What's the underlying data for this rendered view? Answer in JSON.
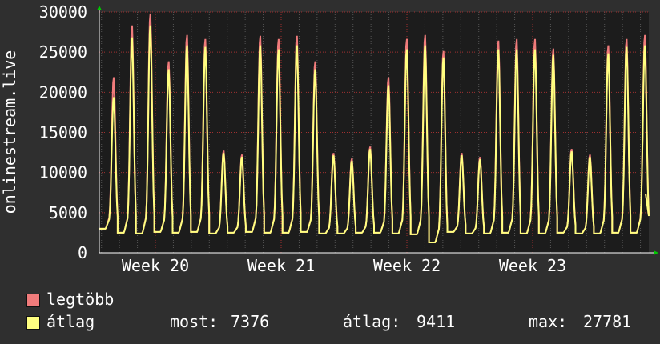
{
  "chart_data": {
    "type": "line",
    "ylabel": "onlinestream.live",
    "yticks": [
      0,
      5000,
      10000,
      15000,
      20000,
      25000,
      30000
    ],
    "ylim": [
      0,
      30000
    ],
    "xticks": [
      "Week 20",
      "Week 21",
      "Week 22",
      "Week 23"
    ],
    "grid": true,
    "series": [
      {
        "name": "legtöbb",
        "color": "#f07b7b"
      },
      {
        "name": "átlag",
        "color": "#ffff80"
      }
    ],
    "daily_peaks_max": [
      22000,
      28500,
      30000,
      24000,
      27300,
      26800,
      12800,
      12300,
      27200,
      26800,
      27200,
      24000,
      12500,
      11800,
      13300,
      22000,
      26800,
      27300,
      25300,
      12500,
      12000,
      26600,
      26800,
      26800,
      25600,
      13000,
      12300,
      26000,
      26800,
      27300
    ],
    "daily_peaks_avg": [
      19500,
      27000,
      28500,
      23000,
      26000,
      25800,
      12500,
      12000,
      26000,
      25500,
      26000,
      23000,
      12200,
      11500,
      13000,
      21000,
      25500,
      26000,
      24500,
      12200,
      11700,
      25500,
      25500,
      25500,
      24800,
      12700,
      12000,
      25000,
      25800,
      26000
    ],
    "daily_troughs": [
      3000,
      2500,
      2400,
      2600,
      2500,
      2600,
      2400,
      2500,
      2600,
      2500,
      2500,
      2600,
      2400,
      2400,
      2500,
      2500,
      2400,
      2300,
      1300,
      2600,
      2400,
      2400,
      2500,
      2400,
      2400,
      2500,
      2400,
      2400,
      2500,
      2500
    ],
    "last_value": 7376,
    "stats": {
      "most_label": "most:",
      "most_value": "7376",
      "atlag_label": "átlag:",
      "atlag_value": "9411",
      "max_label": "max:",
      "max_value": "27781"
    },
    "legend": [
      "legtöbb",
      "átlag"
    ]
  },
  "colors": {
    "background": "#2f2f2f",
    "plot_background": "#1c1c1c",
    "grid_major": "#a03030",
    "grid_minor": "#555555",
    "axis_arrow": "#00cc00"
  }
}
